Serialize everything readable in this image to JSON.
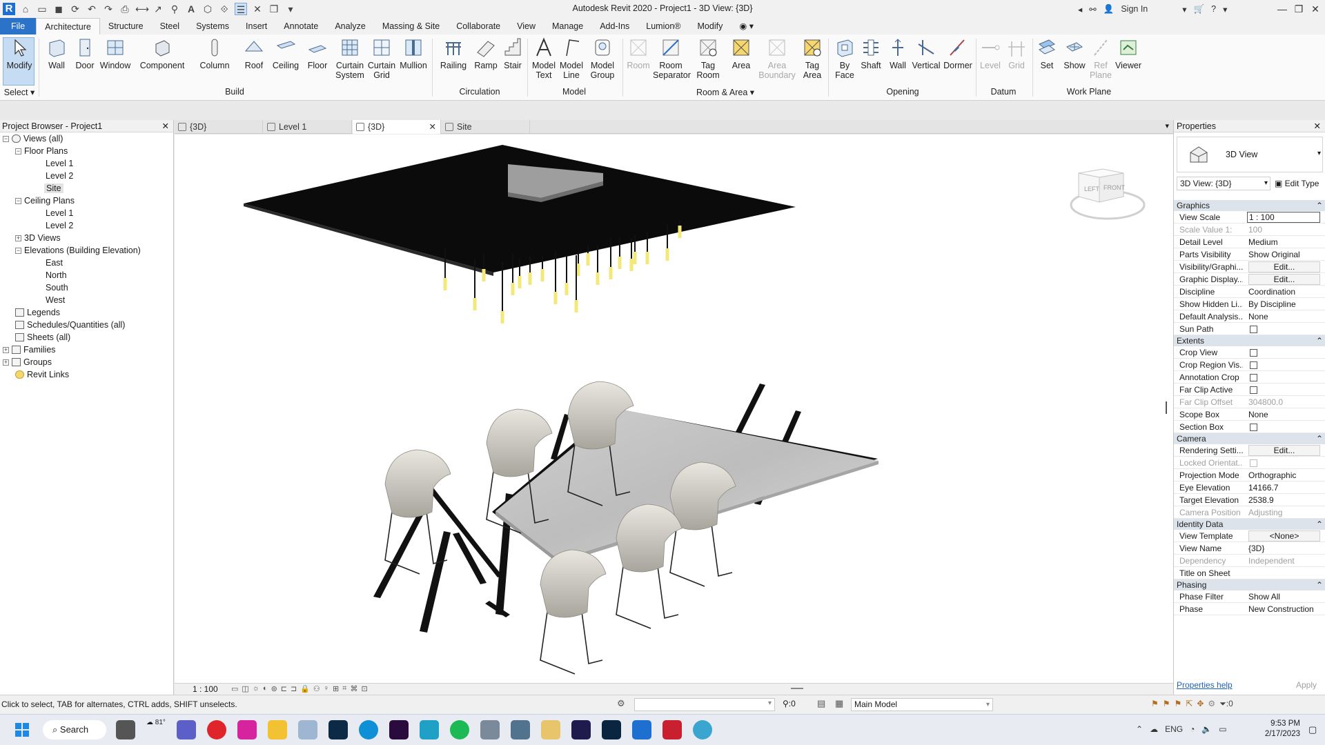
{
  "titlebar": {
    "title": "Autodesk Revit 2020 - Project1 - 3D View: {3D}",
    "sign_in": "Sign In"
  },
  "tabs": [
    "File",
    "Architecture",
    "Structure",
    "Steel",
    "Systems",
    "Insert",
    "Annotate",
    "Analyze",
    "Massing & Site",
    "Collaborate",
    "View",
    "Manage",
    "Add-Ins",
    "Lumion®",
    "Modify"
  ],
  "active_tab": "Architecture",
  "ribbon": {
    "modify": "Modify",
    "select_panel": "Select",
    "build": [
      "Wall",
      "Door",
      "Window",
      "Component",
      "Column",
      "Roof",
      "Ceiling",
      "Floor",
      "Curtain System",
      "Curtain Grid",
      "Mullion"
    ],
    "build_panel": "Build",
    "circulation": [
      "Railing",
      "Ramp",
      "Stair"
    ],
    "circulation_panel": "Circulation",
    "model": [
      "Model Text",
      "Model Line",
      "Model Group"
    ],
    "model_panel": "Model",
    "room": [
      "Room",
      "Room Separator",
      "Tag Room",
      "Area",
      "Area Boundary",
      "Tag Area"
    ],
    "room_panel": "Room & Area",
    "opening": [
      "By Face",
      "Shaft",
      "Wall",
      "Vertical",
      "Dormer"
    ],
    "opening_panel": "Opening",
    "datum": [
      "Level",
      "Grid"
    ],
    "datum_panel": "Datum",
    "workplane": [
      "Set",
      "Show",
      "Ref Plane",
      "Viewer"
    ],
    "workplane_panel": "Work Plane"
  },
  "project_browser": {
    "title": "Project Browser - Project1",
    "nodes": [
      "Views (all)",
      "Floor Plans",
      "Level 1",
      "Level 2",
      "Site",
      "Ceiling Plans",
      "Level 1",
      "Level 2",
      "3D Views",
      "Elevations (Building Elevation)",
      "East",
      "North",
      "South",
      "West",
      "Legends",
      "Schedules/Quantities (all)",
      "Sheets (all)",
      "Families",
      "Groups",
      "Revit Links"
    ]
  },
  "view_tabs": [
    "{3D}",
    "Level 1",
    "{3D}",
    "Site"
  ],
  "viewcube": {
    "left": "LEFT",
    "front": "FRONT"
  },
  "view_scale_label": "1 : 100",
  "properties": {
    "title": "Properties",
    "type_name": "3D View",
    "selector": "3D View: {3D}",
    "edit_type": "Edit Type",
    "groups": {
      "graphics": "Graphics",
      "extents": "Extents",
      "camera": "Camera",
      "identity": "Identity Data",
      "phasing": "Phasing"
    },
    "rows": {
      "view_scale": [
        "View Scale",
        "1 : 100"
      ],
      "scale_value": [
        "Scale Value    1:",
        "100"
      ],
      "detail_level": [
        "Detail Level",
        "Medium"
      ],
      "parts_visibility": [
        "Parts Visibility",
        "Show Original"
      ],
      "vis_graphics": [
        "Visibility/Graphi...",
        "Edit..."
      ],
      "graphic_display": [
        "Graphic Display...",
        "Edit..."
      ],
      "discipline": [
        "Discipline",
        "Coordination"
      ],
      "show_hidden": [
        "Show Hidden Li...",
        "By Discipline"
      ],
      "default_analysis": [
        "Default Analysis...",
        "None"
      ],
      "sun_path": [
        "Sun Path",
        ""
      ],
      "crop_view": [
        "Crop View",
        ""
      ],
      "crop_region": [
        "Crop Region Vis...",
        ""
      ],
      "annotation_crop": [
        "Annotation Crop",
        ""
      ],
      "far_clip_active": [
        "Far Clip Active",
        ""
      ],
      "far_clip_offset": [
        "Far Clip Offset",
        "304800.0"
      ],
      "scope_box": [
        "Scope Box",
        "None"
      ],
      "section_box": [
        "Section Box",
        ""
      ],
      "rendering": [
        "Rendering Setti...",
        "Edit..."
      ],
      "locked_orient": [
        "Locked Orientat...",
        ""
      ],
      "projection": [
        "Projection Mode",
        "Orthographic"
      ],
      "eye_elev": [
        "Eye Elevation",
        "14166.7"
      ],
      "target_elev": [
        "Target Elevation",
        "2538.9"
      ],
      "camera_pos": [
        "Camera Position",
        "Adjusting"
      ],
      "view_template": [
        "View Template",
        "<None>"
      ],
      "view_name": [
        "View Name",
        "{3D}"
      ],
      "dependency": [
        "Dependency",
        "Independent"
      ],
      "title_on_sheet": [
        "Title on Sheet",
        ""
      ],
      "phase_filter": [
        "Phase Filter",
        "Show All"
      ],
      "phase": [
        "Phase",
        "New Construction"
      ]
    },
    "help": "Properties help",
    "apply": "Apply"
  },
  "status": {
    "hint": "Click to select, TAB for alternates, CTRL adds, SHIFT unselects.",
    "workset_count": ":0",
    "model": "Main Model",
    "filter_count": ":0"
  },
  "taskbar": {
    "search": "Search",
    "weather": "81°",
    "lang": "ENG",
    "time": "9:53 PM",
    "date": "2/17/2023"
  }
}
